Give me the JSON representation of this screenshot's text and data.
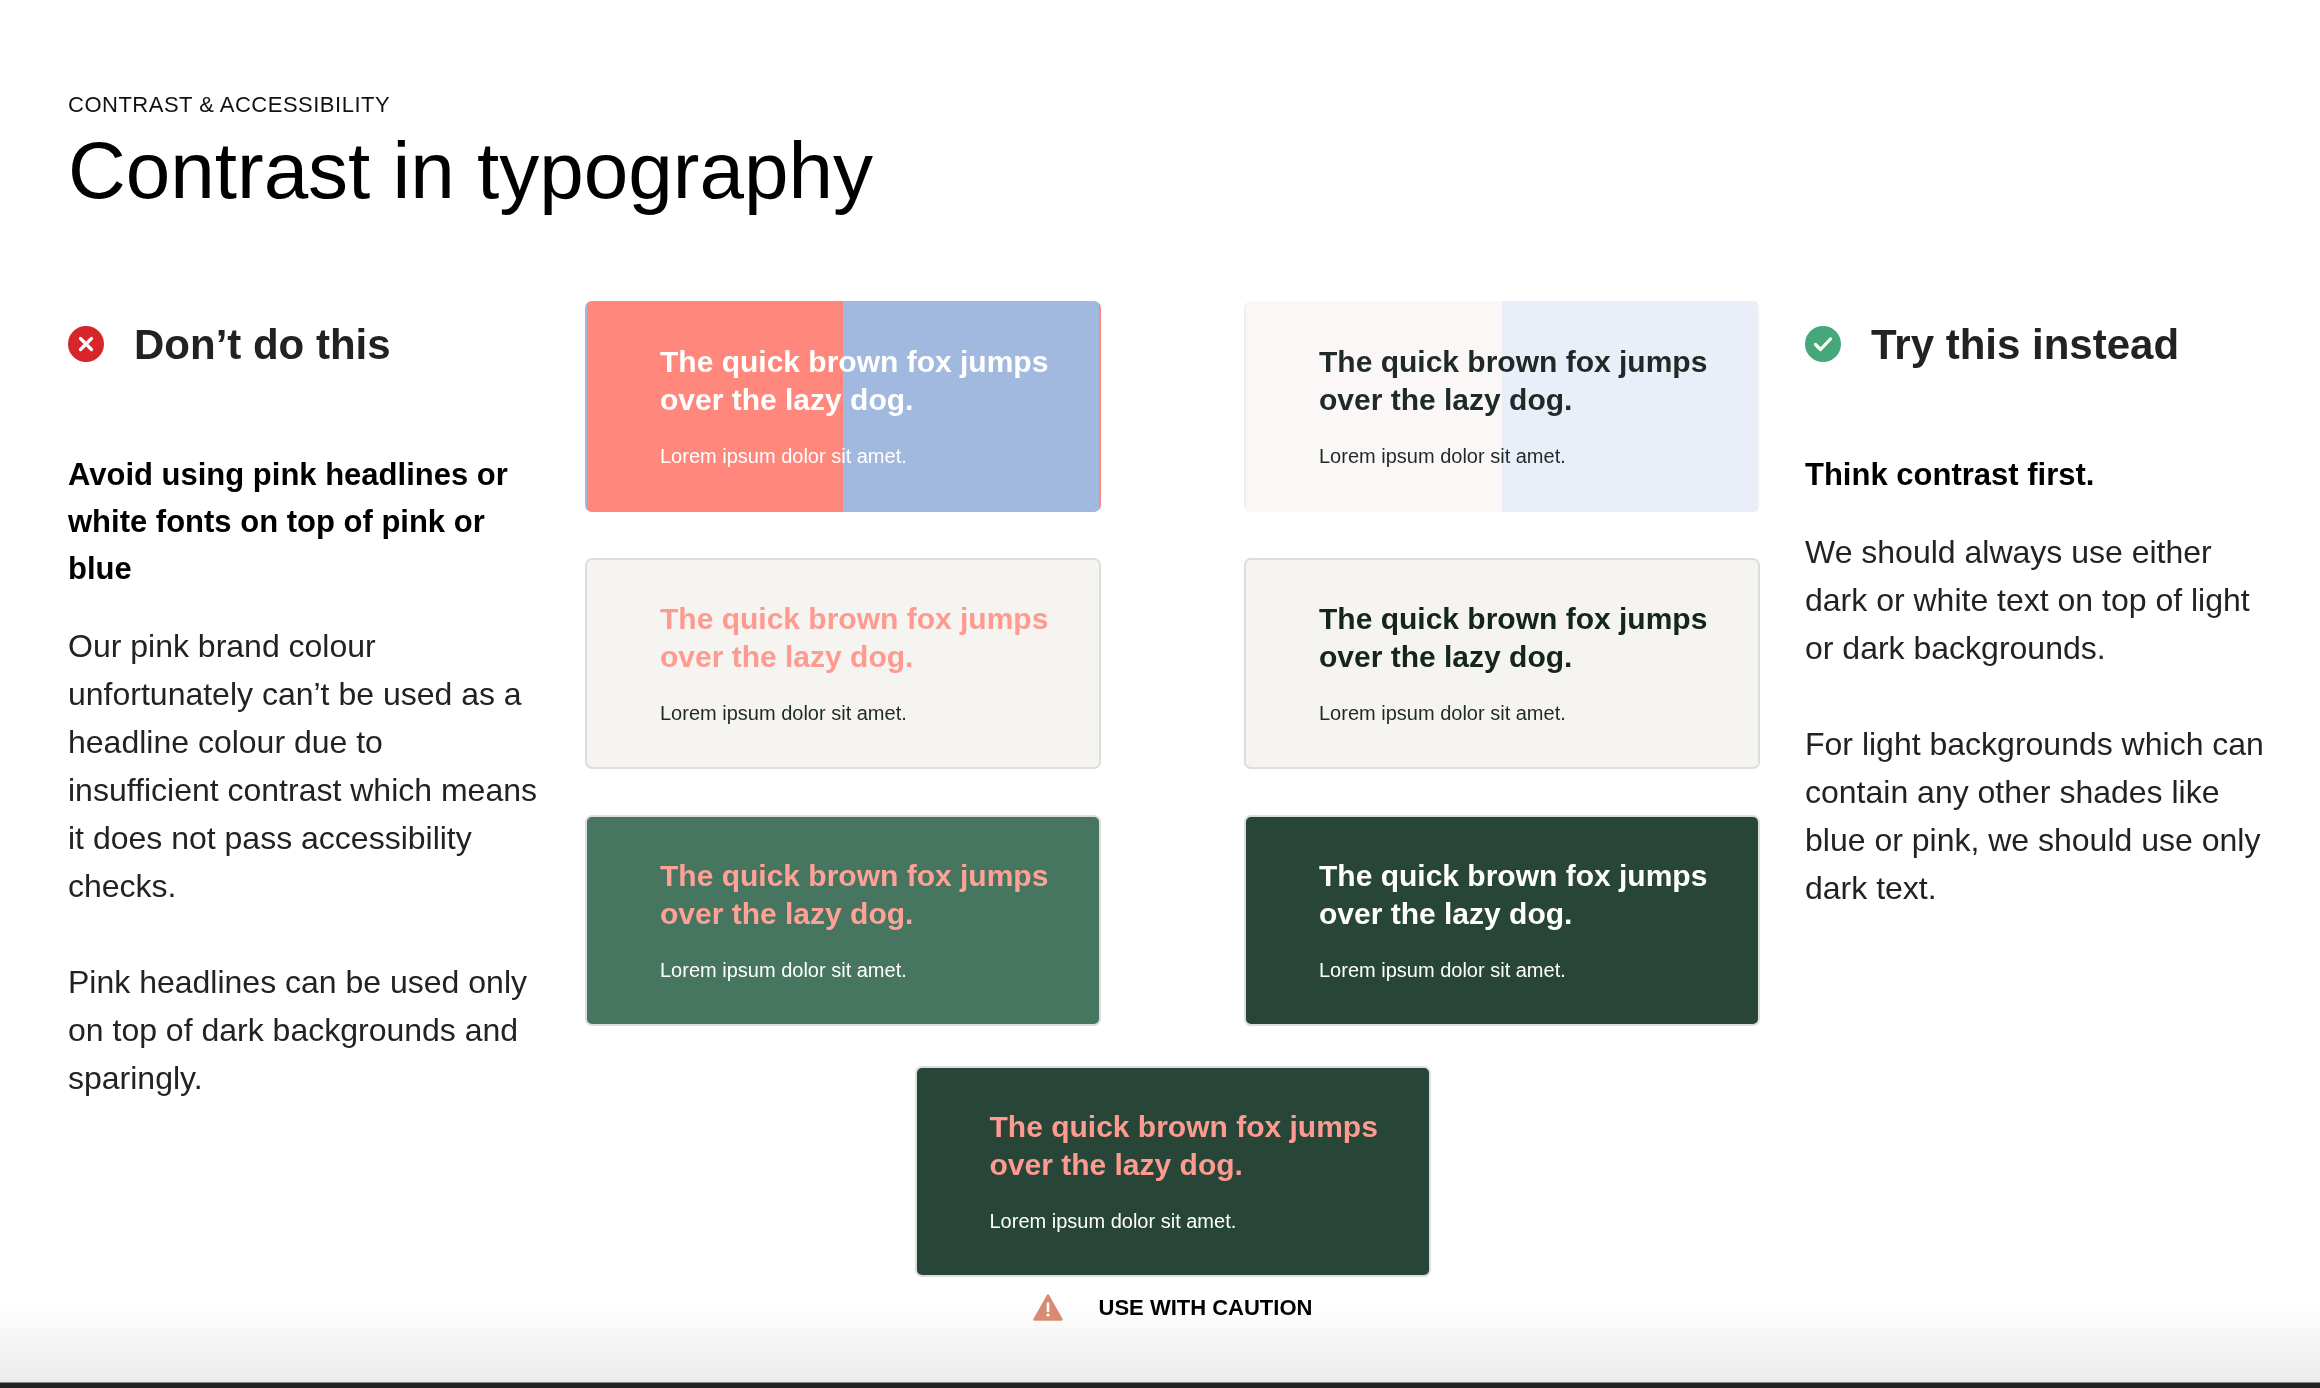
{
  "eyebrow": "CONTRAST & ACCESSIBILITY",
  "title": "Contrast in typography",
  "dont": {
    "heading": "Don’t do this",
    "lead": "Avoid using pink headlines or white fonts on top of pink or blue",
    "paragraphs": [
      "Our pink brand colour unfortunately can’t be used as a headline colour due to insufficient contrast which means it does not pass accessibility checks.",
      "Pink headlines can be used only on top of dark backgrounds and sparingly."
    ]
  },
  "do": {
    "heading": "Try this instead",
    "lead": "Think contrast first.",
    "paragraphs": [
      "We should always use either dark or white text on top of light or dark backgrounds.",
      "For light backgrounds which can contain any other shades like blue or pink, we should use only dark text."
    ]
  },
  "cards": [
    {
      "panels": [
        {
          "color": "#ff877c"
        },
        {
          "color": "#a2b9df"
        }
      ],
      "headline": {
        "text": "The quick brown fox jumps over the lazy dog.",
        "color": "#ffffff"
      },
      "body": {
        "text": "Lorem ipsum dolor sit amet.",
        "color": "#ffffff"
      }
    },
    {
      "panels": [
        {
          "color": "#fbf7f6"
        },
        {
          "color": "#eaeef9"
        }
      ],
      "headline": {
        "text": "The quick brown fox jumps over the lazy dog.",
        "color": "#1e2a26"
      },
      "body": {
        "text": "Lorem ipsum dolor sit amet.",
        "color": "#1e2a26"
      }
    },
    {
      "panels": [
        {
          "color": "#f5f4f1"
        }
      ],
      "headline": {
        "text": "The quick brown fox jumps over the lazy dog.",
        "color": "#ff9a90"
      },
      "body": {
        "text": "Lorem ipsum dolor sit amet.",
        "color": "#1e2a26"
      }
    },
    {
      "panels": [
        {
          "color": "#f5f4f1"
        }
      ],
      "headline": {
        "text": "The quick brown fox jumps over the lazy dog.",
        "color": "#13251e"
      },
      "body": {
        "text": "Lorem ipsum dolor sit amet.",
        "color": "#1e2a26"
      }
    },
    {
      "panels": [
        {
          "color": "#46765f"
        }
      ],
      "headline": {
        "text": "The quick brown fox jumps over the lazy dog.",
        "color": "#ffa197"
      },
      "body": {
        "text": "Lorem ipsum dolor sit amet.",
        "color": "#ffffff"
      }
    },
    {
      "panels": [
        {
          "color": "#284638"
        }
      ],
      "headline": {
        "text": "The quick brown fox jumps over the lazy dog.",
        "color": "#ffffff"
      },
      "body": {
        "text": "Lorem ipsum dolor sit amet.",
        "color": "#ffffff"
      }
    },
    {
      "panels": [
        {
          "color": "#284638"
        }
      ],
      "headline": {
        "text": "The quick brown fox jumps over the lazy dog.",
        "color": "#ff9a90"
      },
      "body": {
        "text": "Lorem ipsum dolor sit amet.",
        "color": "#ffffff"
      }
    }
  ],
  "caution": "USE WITH CAUTION"
}
